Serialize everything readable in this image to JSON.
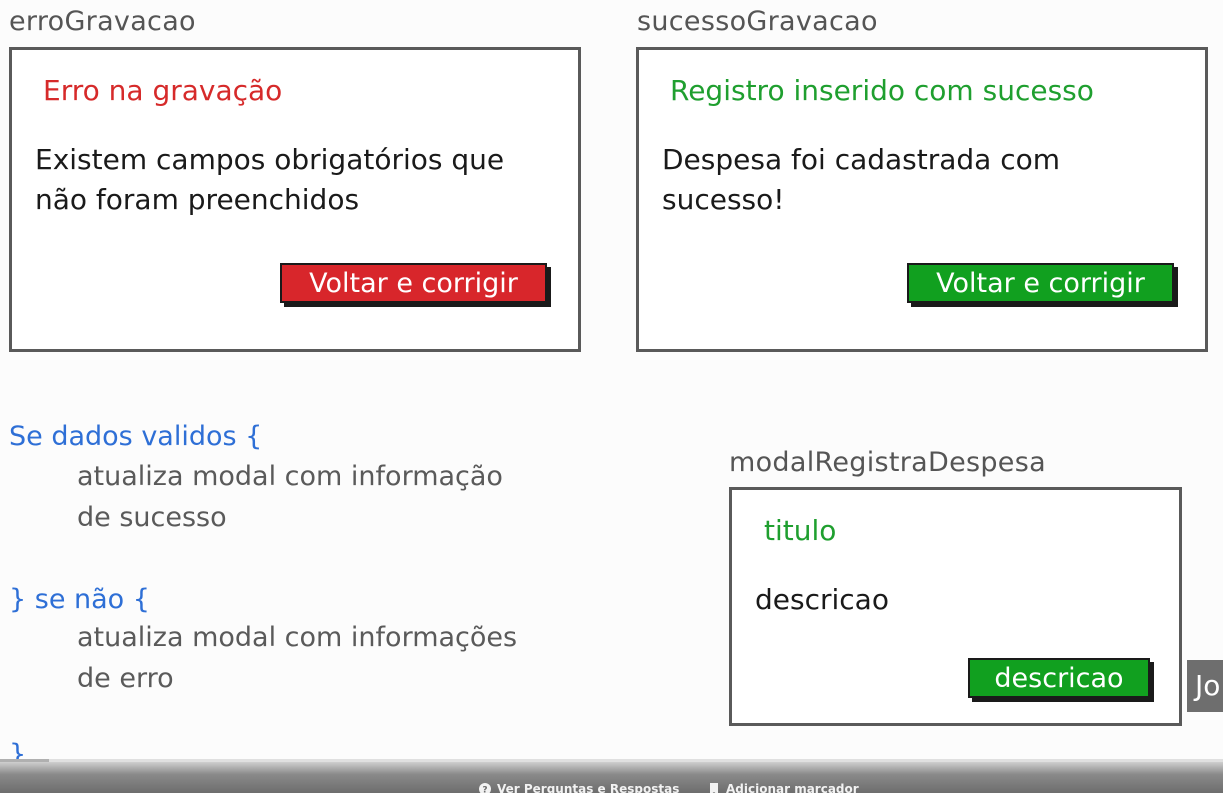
{
  "erro": {
    "label": "erroGravacao",
    "title": "Erro na gravação",
    "body": "Existem campos obrigatórios que não foram preenchidos",
    "button": "Voltar e corrigir",
    "accent": "#d8262b"
  },
  "sucesso": {
    "label": "sucessoGravacao",
    "title": "Registro inserido com sucesso",
    "body": "Despesa foi cadastrada com sucesso!",
    "button": "Voltar e corrigir",
    "accent": "#11a01f"
  },
  "modal": {
    "label": "modalRegistraDespesa",
    "title": "titulo",
    "body": "descricao",
    "button": "descricao",
    "accent": "#11a01f"
  },
  "pseudocode": {
    "line1": "Se dados validos {",
    "line2": "atualiza modal com informação",
    "line3": "de sucesso",
    "line4": "} se não {",
    "line5": "atualiza modal com informações",
    "line6": "de erro",
    "line7": "}"
  },
  "side_tab": {
    "text": "Jo"
  },
  "player_bar": {
    "questions": "Ver Perguntas e Respostas",
    "bookmark": "Adicionar marcador",
    "progress": 0.04
  },
  "icons": [
    "mouse-cursor-icon",
    "question-icon",
    "bookmark-icon"
  ]
}
